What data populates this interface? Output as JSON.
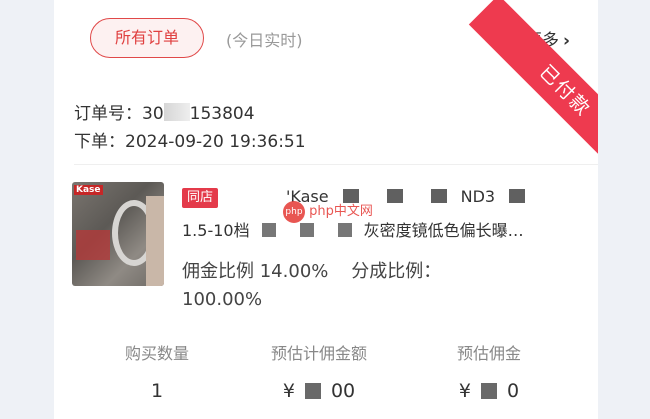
{
  "filters": {
    "all_orders_label": "所有订单",
    "realtime_note": "(今日实时)",
    "more_label": "更多",
    "more_icon": "chevron-right-icon"
  },
  "order": {
    "order_no_label": "订单号：",
    "order_no_visible_prefix": "30",
    "order_no_visible_suffix": "153804",
    "placed_label": "下单：",
    "placed_time": "2024-09-20 19:36:51",
    "status_ribbon": "已付款"
  },
  "product": {
    "shop_tag": "同店",
    "title_line1_parts": [
      "'Kase",
      "ND3"
    ],
    "title_line2_start": "1.5-10档",
    "title_line2_end": "灰密度镜低色偏长曝…",
    "thumbnail_brand": "Kase",
    "commission_rate_label": "佣金比例",
    "commission_rate": "14.00%",
    "share_ratio_label": "分成比例：",
    "share_ratio": "100.00%"
  },
  "stats": [
    {
      "label": "购买数量",
      "value": "1"
    },
    {
      "label": "预估计佣金额",
      "value_prefix": "¥",
      "value_suffix": "00"
    },
    {
      "label": "预估佣金",
      "value_prefix": "¥",
      "value_suffix": "0"
    }
  ],
  "watermark": {
    "text": "php中文网",
    "logo": "php"
  },
  "colors": {
    "accent_red": "#e04040",
    "ribbon_red": "#ee3a4f",
    "text_dark": "#333333",
    "text_muted": "#999999",
    "background": "#eef1f6"
  }
}
